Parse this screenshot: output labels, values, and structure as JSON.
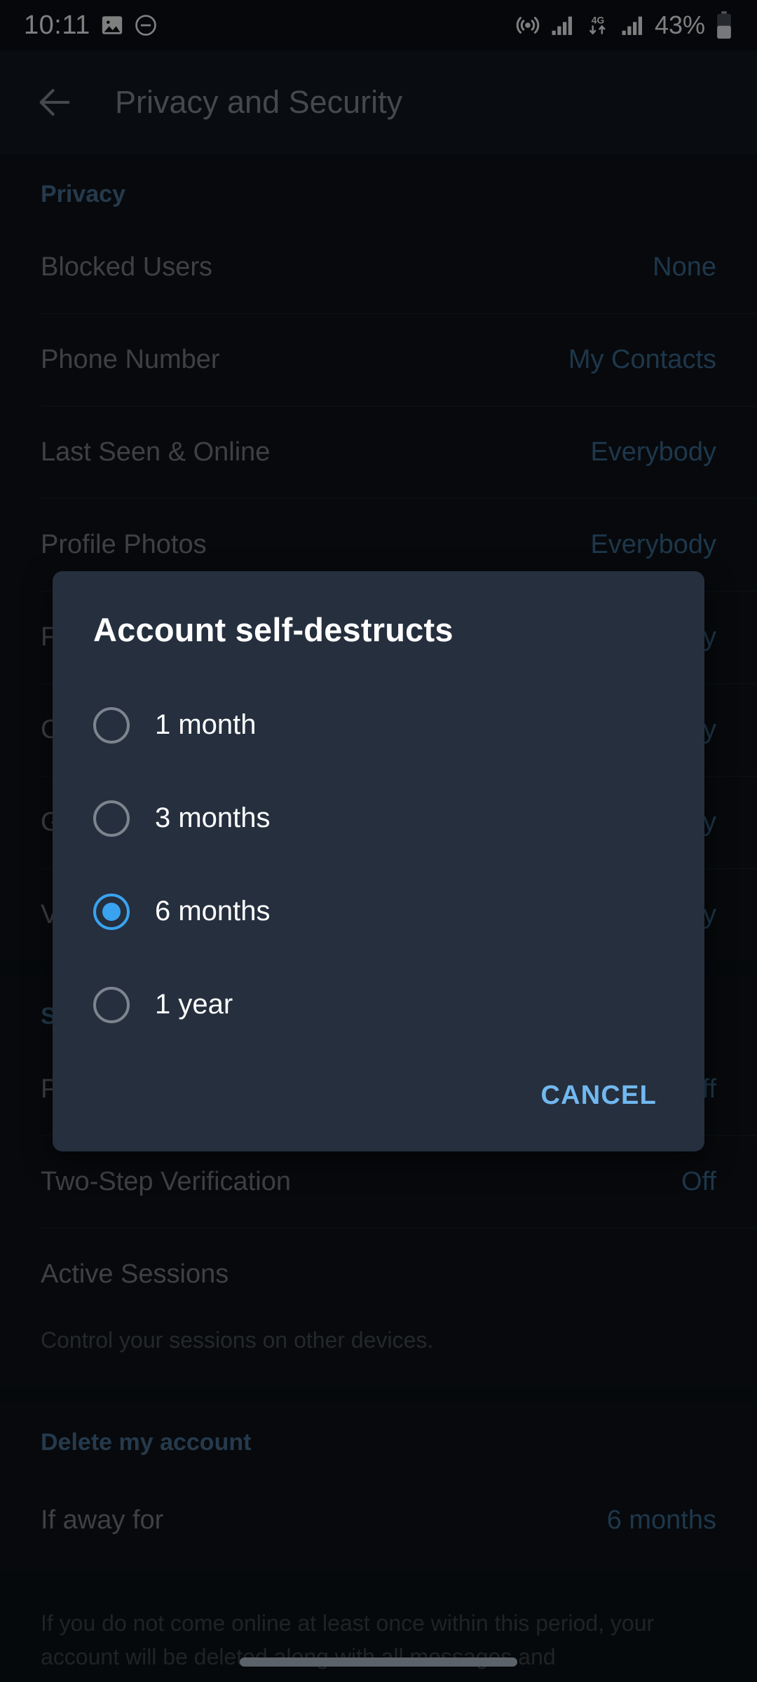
{
  "status_bar": {
    "time": "10:11",
    "left_icons": [
      "image-icon",
      "do-not-disturb-icon"
    ],
    "right_icons": [
      "hotspot-icon",
      "signal-bars-icon",
      "4g-data-icon",
      "signal-bars-2-icon"
    ],
    "network_label": "4G",
    "battery_percent": "43%"
  },
  "app_bar": {
    "back_icon": "arrow-left-icon",
    "title": "Privacy and Security"
  },
  "colors": {
    "accent_blue": "#3d6e96",
    "section_header_blue": "#4a7599",
    "radio_selected": "#39a3f0",
    "cancel_blue": "#72b8f0",
    "dialog_bg": "#252f3e",
    "page_bg": "#0e1319"
  },
  "privacy_section": {
    "header": "Privacy",
    "rows": [
      {
        "label": "Blocked Users",
        "value": "None"
      },
      {
        "label": "Phone Number",
        "value": "My Contacts"
      },
      {
        "label": "Last Seen & Online",
        "value": "Everybody"
      },
      {
        "label": "Profile Photos",
        "value": "Everybody"
      },
      {
        "label": "Forwarded Messages",
        "value": "Everybody"
      },
      {
        "label": "Calls",
        "value": "Everybody"
      },
      {
        "label": "Groups & Channels",
        "value": "Everybody"
      },
      {
        "label": "Voice Messages",
        "value": "Everybody"
      }
    ]
  },
  "security_section": {
    "header": "Security",
    "rows": [
      {
        "label": "Passcode Lock",
        "value": "Off"
      },
      {
        "label": "Two-Step Verification",
        "value": "Off"
      },
      {
        "label": "Active Sessions",
        "value": ""
      }
    ],
    "note": "Control your sessions on other devices."
  },
  "delete_section": {
    "header": "Delete my account",
    "rows": [
      {
        "label": "If away for",
        "value": "6 months"
      }
    ],
    "note": "If you do not come online at least once within this period, your account will be deleted along with all messages and"
  },
  "dialog": {
    "title": "Account self-destructs",
    "options": [
      {
        "label": "1 month",
        "selected": false
      },
      {
        "label": "3 months",
        "selected": false
      },
      {
        "label": "6 months",
        "selected": true
      },
      {
        "label": "1 year",
        "selected": false
      }
    ],
    "cancel_label": "CANCEL"
  }
}
